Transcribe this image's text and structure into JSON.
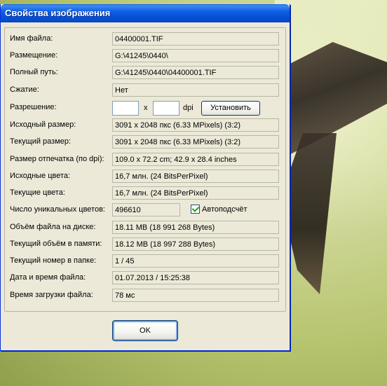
{
  "window": {
    "title": "Свойства изображения"
  },
  "rows": [
    {
      "label": "Имя файла:",
      "value": "04400001.TIF"
    },
    {
      "label": "Размещение:",
      "value": "G:\\41245\\0440\\"
    },
    {
      "label": "Полный путь:",
      "value": "G:\\41245\\0440\\04400001.TIF"
    },
    {
      "label": "Сжатие:",
      "value": "Нет"
    },
    {
      "label": "Разрешение:",
      "value": ""
    },
    {
      "label": "Исходный размер:",
      "value": "3091 x 2048  пкс (6.33 MPixels) (3:2)"
    },
    {
      "label": "Текущий размер:",
      "value": "3091 x 2048  пкс (6.33 MPixels) (3:2)"
    },
    {
      "label": "Размер отпечатка (по dpi):",
      "value": "109.0 x 72.2 cm; 42.9 x 28.4 inches"
    },
    {
      "label": "Исходные цвета:",
      "value": "16,7 млн.   (24 BitsPerPixel)"
    },
    {
      "label": "Текущие цвета:",
      "value": "16,7 млн.   (24 BitsPerPixel)"
    },
    {
      "label": "Число уникальных цветов:",
      "value": "496610"
    },
    {
      "label": "Объём файла на диске:",
      "value": "18.11 MB (18 991 268 Bytes)"
    },
    {
      "label": "Текущий объём в памяти:",
      "value": "18.12  MB (18 997 288 Bytes)"
    },
    {
      "label": "Текущий номер в папке:",
      "value": "1  /  45"
    },
    {
      "label": "Дата и время файла:",
      "value": "01.07.2013 / 15:25:38"
    },
    {
      "label": "Время загрузки файла:",
      "value": "78 мс"
    }
  ],
  "resolution": {
    "x_sep": "x",
    "unit": "dpi",
    "set_button": "Установить"
  },
  "autocount": {
    "label": "Автоподсчёт",
    "checked": true
  },
  "ok_button": "OK"
}
